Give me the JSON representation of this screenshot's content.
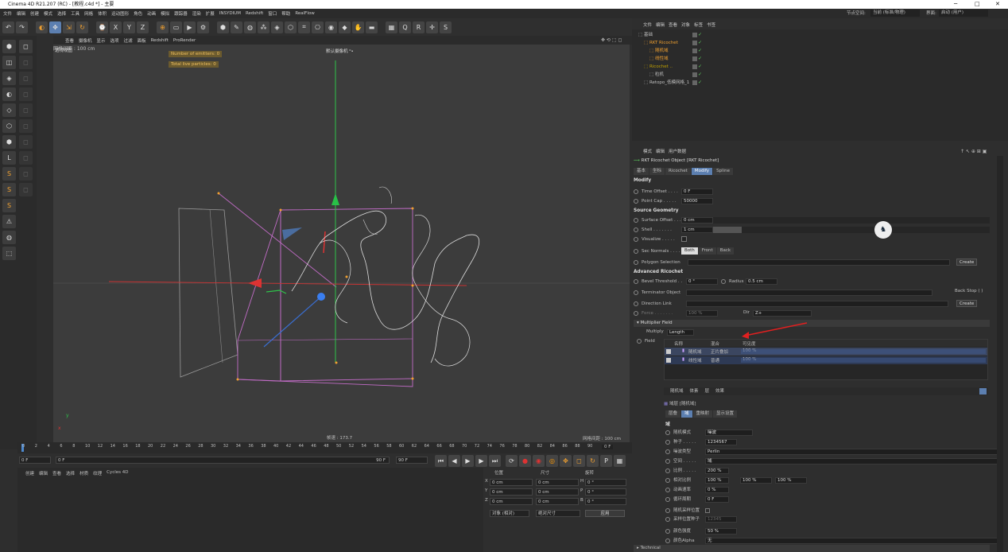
{
  "window": {
    "title": "Cinema 4D R21.207 (RC) - [教程.c4d *] - 主要",
    "min": "─",
    "max": "□",
    "close": "✕"
  },
  "menu": [
    "文件",
    "编辑",
    "创建",
    "模式",
    "选择",
    "工具",
    "网格",
    "体积",
    "运动图形",
    "角色",
    "动画",
    "模拟",
    "跟踪器",
    "渲染",
    "扩展",
    "INSYDIUM",
    "Redshift",
    "窗口",
    "帮助",
    "RealFlow"
  ],
  "menu_right": {
    "interface_label": "界面:",
    "interface_value": "启动 (用户)",
    "node_label": "节点空间:",
    "node_value": "当前 (标准/物理)"
  },
  "toolbar_icons": [
    "undo-icon",
    "redo-icon",
    "live-select-icon",
    "move-icon",
    "scale-icon",
    "rotate-icon",
    "recent-icon",
    "x-axis-icon",
    "y-axis-icon",
    "z-axis-icon",
    "coord-icon",
    "render-region-icon",
    "render-view-icon",
    "render-settings-icon",
    "cube-icon",
    "pen-icon",
    "subdivide-icon",
    "cloner-icon",
    "effector-icon",
    "deformer-icon",
    "scene-icon",
    "camera-icon",
    "light-icon",
    "tag-icon",
    "sculpt-icon",
    "floor-icon",
    "grid-icon",
    "qr-icon",
    "rr-icon",
    "target-icon",
    "s-icon"
  ],
  "viewport": {
    "menu": [
      "查看",
      "摄像机",
      "显示",
      "选项",
      "过滤",
      "面板",
      "Redshift",
      "ProRender"
    ],
    "label": "透视视图",
    "camera": "默认摄像机 ⁰•",
    "hud": [
      "Number of emitters: 0",
      "Total live particles: 0"
    ],
    "grid_spacing": "网格间距 : 100 cm",
    "fps": "帧速 : 173.7",
    "corner_axis": "Y  X  Z"
  },
  "timeline": {
    "ticks": [
      "0",
      "2",
      "4",
      "6",
      "8",
      "10",
      "12",
      "14",
      "16",
      "18",
      "20",
      "22",
      "24",
      "26",
      "28",
      "30",
      "32",
      "34",
      "36",
      "38",
      "40",
      "42",
      "44",
      "46",
      "48",
      "50",
      "52",
      "54",
      "56",
      "58",
      "60",
      "62",
      "64",
      "66",
      "68",
      "70",
      "72",
      "74",
      "76",
      "78",
      "80",
      "82",
      "84",
      "86",
      "88",
      "90"
    ],
    "current": "0 F"
  },
  "transport": {
    "start": "0 F",
    "pos": "0 F",
    "end": "90 F",
    "end2": "90 F"
  },
  "material_menu": [
    "创建",
    "编辑",
    "查看",
    "选择",
    "材质",
    "纹理",
    "Cycles 4D"
  ],
  "coords": {
    "headers": [
      "位置",
      "尺寸",
      "旋转"
    ],
    "rows": [
      {
        "axis": "X",
        "pos": "0 cm",
        "size": "0 cm",
        "rot_axis": "H",
        "rot": "0 °"
      },
      {
        "axis": "Y",
        "pos": "0 cm",
        "size": "0 cm",
        "rot_axis": "P",
        "rot": "0 °"
      },
      {
        "axis": "Z",
        "pos": "0 cm",
        "size": "0 cm",
        "rot_axis": "B",
        "rot": "0 °"
      }
    ],
    "mode": "对象 (相对)",
    "size_mode": "绝对尺寸",
    "apply": "应用"
  },
  "objmgr": {
    "tabs": [
      "文件",
      "编辑",
      "查看",
      "对象",
      "标签",
      "书签"
    ],
    "rows": [
      {
        "name": "基础",
        "indent": 0,
        "color": "#bfbfbf"
      },
      {
        "name": "RKT Ricochet",
        "indent": 1,
        "color": "#f0a030"
      },
      {
        "name": "随机域",
        "indent": 2,
        "color": "#f0a030"
      },
      {
        "name": "线性域",
        "indent": 2,
        "color": "#f0a030"
      },
      {
        "name": "Ricochet ..",
        "indent": 1,
        "color": "#c0a000"
      },
      {
        "name": "粒机",
        "indent": 2,
        "color": "#bfbfbf"
      },
      {
        "name": "Retopo_低模网格_1",
        "indent": 1,
        "color": "#bfbfbf"
      }
    ]
  },
  "attr": {
    "tabs": [
      "模式",
      "编辑",
      "用户数据"
    ],
    "object_title": "RKT Ricochet Object [RKT Ricochet]",
    "subtabs": [
      "基本",
      "坐标",
      "Ricochet",
      "Modify",
      "Spline"
    ],
    "active_subtab": "Modify",
    "modify_title": "Modify",
    "time_offset_label": "Time Offset . . . .",
    "time_offset": "0 F",
    "point_cap_label": "Point Cap . . . . .",
    "point_cap": "50000",
    "source_title": "Source Geometry",
    "surface_offset_label": "Surface Offset . . .",
    "surface_offset": "0 cm",
    "shell_label": "Shell . . . . . . .",
    "shell": "1 cm",
    "visualize_label": "Visualize . . . . .",
    "sec_normals_label": "Sec Normals . . . .",
    "normals": [
      "Both",
      "Front",
      "Back"
    ],
    "polygon_selection_label": "Polygon Selection",
    "create": "Create",
    "adv_title": "Advanced Ricochet",
    "bevel_label": "Bevel Threshold . .",
    "bevel": "0 °",
    "radius_label": "Radius",
    "radius": "0.5 cm",
    "terminator_label": "Terminator Object",
    "backstop_label": "Back Stop ( )",
    "direction_label": "Direction Link",
    "force_label": "Force . . . . . . .",
    "force": "100 %",
    "dir_label": "Dir",
    "dir": "Z+",
    "multiplier_title": "▾ Multiplier Field",
    "multiply_label": "Multiply",
    "multiply": "Length",
    "field_label": "Field",
    "field_headers": [
      "名称",
      "混合",
      "可见度"
    ],
    "field_rows": [
      {
        "name": "随机域",
        "blend": "正片叠加",
        "vis": "100 %"
      },
      {
        "name": "线性域",
        "blend": "普通",
        "vis": "100 %"
      }
    ],
    "bottom_tabs": [
      "随机域",
      "体素",
      "层",
      "效果"
    ],
    "domain_title": "域层 [随机域]",
    "domain_tabs": [
      "层叠",
      "域",
      "重映射",
      "显示设置"
    ],
    "active_domain_tab": "域",
    "domain_section": "域",
    "random_mode_label": "随机模式",
    "random_mode": "噪波",
    "seed_label": "种子 . . . . .",
    "seed": "1234567",
    "noise_label": "噪波类型",
    "noise": "Perlin",
    "space_label": "空间 . . . . .",
    "space": "域",
    "scale_label": "比例 . . . . .",
    "scale": "200 %",
    "rel_scale_label": "相对比例",
    "rel_scale": [
      "100 %",
      "100 %",
      "100 %"
    ],
    "anim_speed_label": "动画速率",
    "anim_speed": "0 %",
    "loop_label": "循环周期",
    "loop": "0 F",
    "sample_label": "随机采样位置",
    "seed2_label": "采样位置种子",
    "seed2": "12345",
    "contrast_label": "颜色强度",
    "contrast": "50 %",
    "alpha_label": "颜色Alpha",
    "alpha": "无",
    "technical": "▸ Technical"
  }
}
